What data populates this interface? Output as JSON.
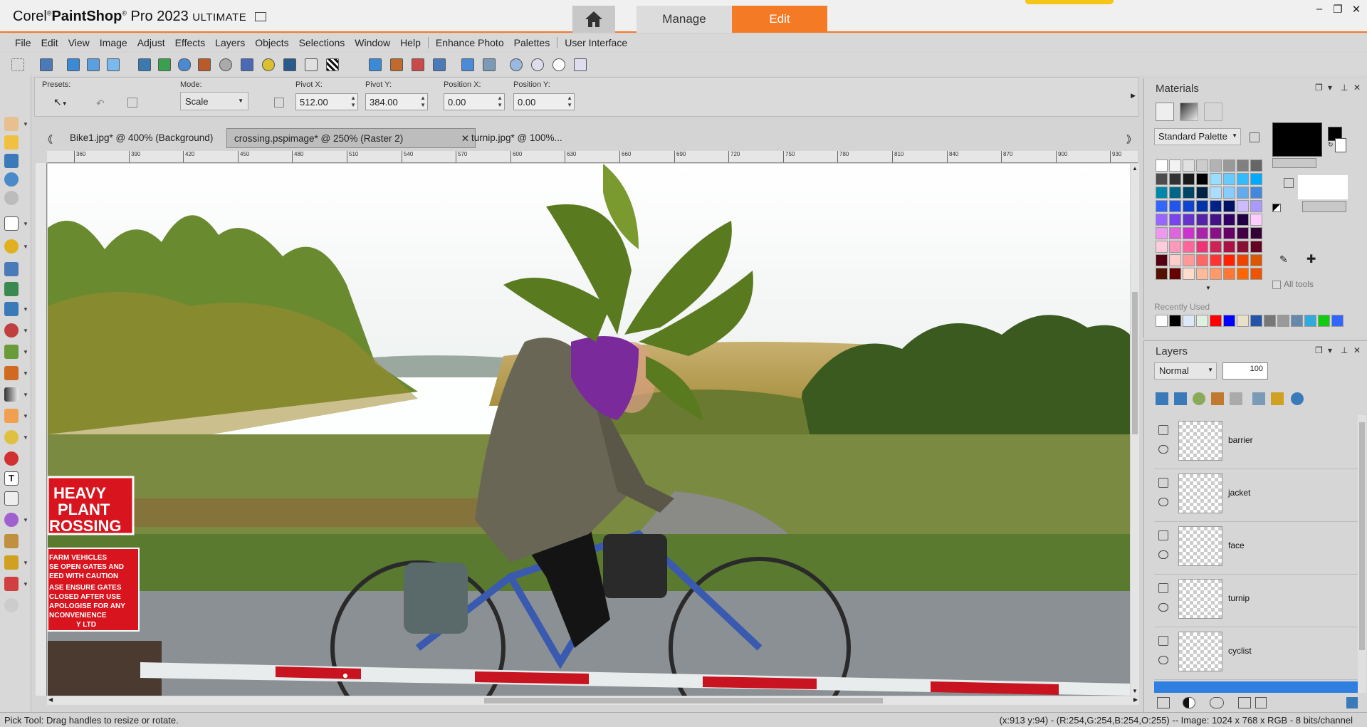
{
  "app": {
    "title_brand": "Corel",
    "title_product": "PaintShop",
    "title_rest": "Pro 2023",
    "title_edition": "ULTIMATE",
    "manage_label": "Manage",
    "edit_label": "Edit",
    "accent": "#f57a26"
  },
  "window_controls": {
    "minimize": "–",
    "restore": "❐",
    "close": "✕"
  },
  "menu": [
    "File",
    "Edit",
    "View",
    "Image",
    "Adjust",
    "Effects",
    "Layers",
    "Objects",
    "Selections",
    "Window",
    "Help",
    "Enhance Photo",
    "Palettes",
    "User Interface"
  ],
  "tool_options": {
    "presets_label": "Presets:",
    "mode_label": "Mode:",
    "mode_value": "Scale",
    "pivot_x_label": "Pivot X:",
    "pivot_x_value": "512.00",
    "pivot_y_label": "Pivot Y:",
    "pivot_y_value": "384.00",
    "position_x_label": "Position X:",
    "position_x_value": "0.00",
    "position_y_label": "Position Y:",
    "position_y_value": "0.00"
  },
  "doc_tabs": {
    "tab1": "Bike1.jpg* @ 400% (Background)",
    "tab2": "crossing.pspimage* @ 250% (Raster 2)",
    "tab3": "turnip.jpg* @ 100%...",
    "close": "✕",
    "prev": "《",
    "next": "》"
  },
  "ruler_labels": [
    "360",
    "390",
    "420",
    "450",
    "480",
    "510",
    "540",
    "570",
    "600",
    "630",
    "660",
    "690",
    "720",
    "750",
    "780",
    "810",
    "840",
    "870",
    "900",
    "930"
  ],
  "canvas": {
    "sign_line1": "HEAVY",
    "sign_line2": "PLANT",
    "sign_line3": "ROSSING",
    "notice_lines": [
      "FARM VEHICLES",
      "SE OPEN GATES AND",
      "EED WITH CAUTION",
      "ASE ENSURE GATES",
      "CLOSED AFTER USE",
      "APOLOGISE FOR ANY",
      "NCONVENIENCE",
      "Y LTD"
    ]
  },
  "materials": {
    "title": "Materials",
    "palette_label": "Standard Palette",
    "recently_used_label": "Recently Used",
    "all_tools_label": "All tools",
    "swatches": [
      [
        "#ffffff",
        "#f2f2f2",
        "#e0e0e0",
        "#cccccc",
        "#b3b3b3",
        "#999999",
        "#808080",
        "#666666"
      ],
      [
        "#4d4d4d",
        "#333333",
        "#1a1a1a",
        "#000000",
        "#99ddff",
        "#66ccff",
        "#33bbff",
        "#00aaff"
      ],
      [
        "#0088aa",
        "#006688",
        "#004466",
        "#002244",
        "#aaddff",
        "#88ccff",
        "#66aaee",
        "#4488dd"
      ],
      [
        "#3366ff",
        "#2255ee",
        "#1144cc",
        "#0033aa",
        "#002288",
        "#001166",
        "#ccbbff",
        "#aa99ff"
      ],
      [
        "#9966ff",
        "#7744ee",
        "#6633cc",
        "#5522aa",
        "#441188",
        "#330066",
        "#220044",
        "#ffccff"
      ],
      [
        "#ee99ee",
        "#dd66dd",
        "#cc33cc",
        "#aa22aa",
        "#881188",
        "#660066",
        "#440044",
        "#330033"
      ],
      [
        "#ffccdd",
        "#ff99bb",
        "#ff6699",
        "#ee3377",
        "#cc2255",
        "#aa1144",
        "#881133",
        "#660022"
      ],
      [
        "#550011",
        "#ffcccc",
        "#ff9999",
        "#ff6666",
        "#ff3333",
        "#ff2200",
        "#ee4400",
        "#dd5500"
      ],
      [
        "#551100",
        "#660000",
        "#ffddcc",
        "#ffbb99",
        "#ff9966",
        "#ff7733",
        "#ff6600",
        "#ee5500"
      ]
    ],
    "recent": [
      "#ffffff",
      "#000000",
      "#dde8f8",
      "#e0f0e0",
      "#ff0000",
      "#0000ff",
      "#e8e0c8",
      "#2255aa",
      "#777777",
      "#999999",
      "#6688aa",
      "#33aadd",
      "#11cc11",
      "#3366ff"
    ],
    "fg_color": "#000000",
    "bg_color": "#ffffff"
  },
  "layers": {
    "title": "Layers",
    "blend_mode": "Normal",
    "opacity": "100",
    "rows": [
      {
        "name": "barrier"
      },
      {
        "name": "jacket"
      },
      {
        "name": "face"
      },
      {
        "name": "turnip"
      },
      {
        "name": "cyclist"
      }
    ]
  },
  "status": {
    "left": "Pick Tool: Drag handles to resize or rotate.",
    "right": "(x:913 y:94) - (R:254,G:254,B:254,O:255) -- Image:  1024 x 768 x RGB - 8 bits/channel"
  }
}
